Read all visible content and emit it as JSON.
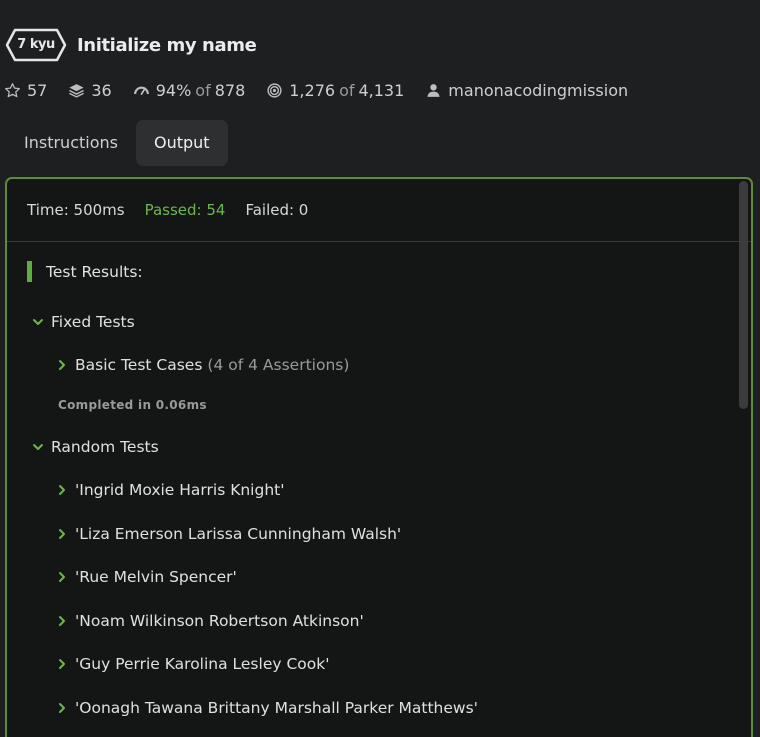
{
  "header": {
    "kyu": "7 kyu",
    "title": "Initialize my name"
  },
  "stats": {
    "stars": "57",
    "collections": "36",
    "satisfaction": "94%",
    "satisfaction_of": "of",
    "satisfaction_total": "878",
    "completed": "1,276",
    "completed_of": "of",
    "completed_total": "4,131",
    "author": "manonacodingmission"
  },
  "tabs": [
    {
      "label": "Instructions"
    },
    {
      "label": "Output"
    }
  ],
  "output": {
    "time": "Time: 500ms",
    "passed": "Passed: 54",
    "failed": "Failed: 0",
    "results_heading": "Test Results:",
    "fixed_tests": {
      "label": "Fixed Tests",
      "basic_label": "Basic Test Cases",
      "basic_assertions": "(4 of 4 Assertions)",
      "completed": "Completed in 0.06ms"
    },
    "random_tests": {
      "label": "Random Tests",
      "items": [
        "'Ingrid Moxie Harris Knight'",
        "'Liza Emerson Larissa Cunningham Walsh'",
        "'Rue Melvin Spencer'",
        "'Noam Wilkinson Robertson Atkinson'",
        "'Guy Perrie Karolina Lesley Cook'",
        "'Oonagh Tawana Brittany Marshall Parker Matthews'"
      ]
    }
  },
  "colors": {
    "accent_green": "#5d8c34",
    "passed_green": "#6cb74a",
    "background": "#1e1f20"
  }
}
